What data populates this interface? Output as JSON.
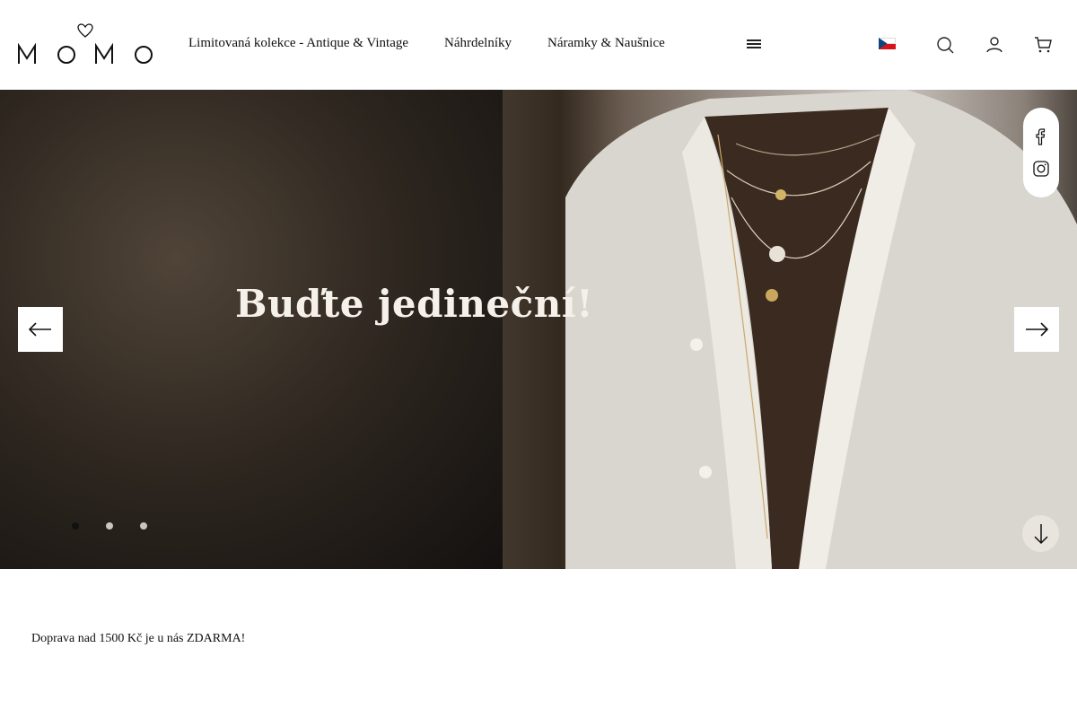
{
  "header": {
    "logo_text": "M O M O",
    "nav": [
      {
        "label": "Limitovaná kolekce - Antique & Vintage"
      },
      {
        "label": "Náhrdelníky"
      },
      {
        "label": "Náramky & Naušnice"
      }
    ],
    "language": {
      "flag": "cz-flag-icon",
      "caret": ""
    },
    "icons": [
      "menu-icon",
      "search-icon",
      "user-icon",
      "cart-icon"
    ]
  },
  "hero": {
    "title": "Buďte jedineční!",
    "slides": [
      {
        "active": true
      },
      {
        "active": false
      },
      {
        "active": false
      }
    ],
    "social": [
      "facebook-icon",
      "instagram-icon"
    ]
  },
  "promo": {
    "shipping_text": "Doprava nad 1500 Kč je u nás ZDARMA!"
  },
  "colors": {
    "background": "#ffffff",
    "text": "#111111",
    "hero_title": "#f5f1ea",
    "dot_active": "#111111",
    "dot_inactive": "#c9c5bf"
  }
}
